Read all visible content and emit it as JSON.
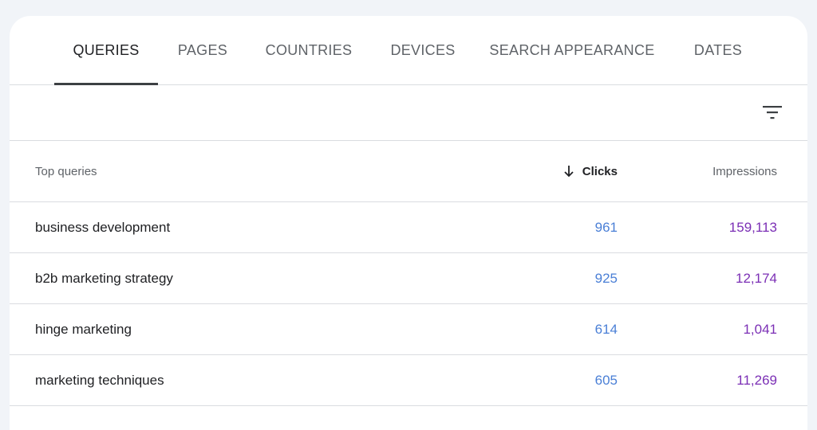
{
  "tabs": [
    {
      "label": "QUERIES",
      "active": true
    },
    {
      "label": "PAGES",
      "active": false
    },
    {
      "label": "COUNTRIES",
      "active": false
    },
    {
      "label": "DEVICES",
      "active": false
    },
    {
      "label": "SEARCH APPEARANCE",
      "active": false
    },
    {
      "label": "DATES",
      "active": false
    }
  ],
  "toolbar": {
    "filter_icon": "filter-list-icon"
  },
  "table": {
    "headers": {
      "query": "Top queries",
      "clicks": "Clicks",
      "impressions": "Impressions",
      "sort_icon": "arrow-down-icon"
    },
    "rows": [
      {
        "query": "business development",
        "clicks": "961",
        "impressions": "159,113"
      },
      {
        "query": "b2b marketing strategy",
        "clicks": "925",
        "impressions": "12,174"
      },
      {
        "query": "hinge marketing",
        "clicks": "614",
        "impressions": "1,041"
      },
      {
        "query": "marketing techniques",
        "clicks": "605",
        "impressions": "11,269"
      }
    ]
  },
  "colors": {
    "clicks": "#4a7fd6",
    "impressions": "#7b2fb5",
    "background": "#f1f4f8"
  }
}
